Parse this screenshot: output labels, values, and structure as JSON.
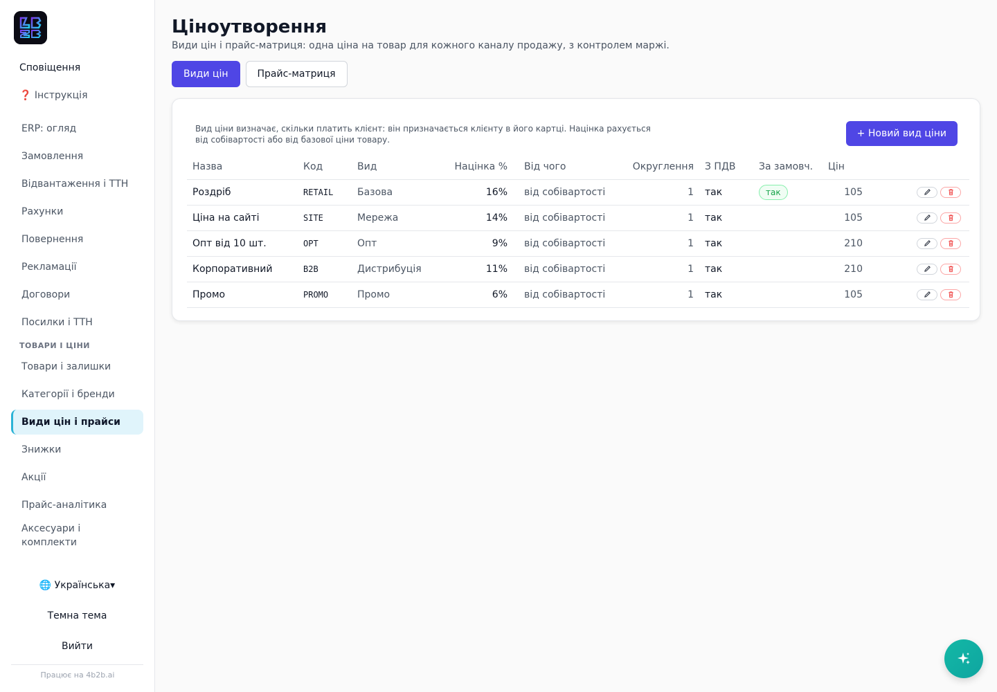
{
  "sidebar": {
    "top_items": [
      {
        "label": "Сповіщення"
      },
      {
        "label": "❓ Інструкція"
      }
    ],
    "erp_items": [
      {
        "label": "ERP: огляд"
      },
      {
        "label": "Замовлення"
      },
      {
        "label": "Відвантаження і ТТН"
      },
      {
        "label": "Рахунки"
      },
      {
        "label": "Повернення"
      },
      {
        "label": "Рекламації"
      },
      {
        "label": "Договори"
      },
      {
        "label": "Посилки і ТТН"
      }
    ],
    "section_title": "ТОВАРИ І ЦІНИ",
    "goods_items": [
      {
        "label": "Товари і залишки"
      },
      {
        "label": "Категорії і бренди"
      },
      {
        "label": "Види цін і прайси"
      },
      {
        "label": "Знижки"
      },
      {
        "label": "Акції"
      },
      {
        "label": "Прайс-аналітика"
      },
      {
        "label": "Аксесуари і комплекти"
      }
    ],
    "active_label": "Види цін і прайси",
    "language": "🌐 Українська▾",
    "theme": "Темна тема",
    "logout": "Вийти",
    "powered_by": "Працює на 4b2b.ai"
  },
  "header": {
    "title": "Ціноутворення",
    "subtitle": "Види цін і прайс-матриця: одна ціна на товар для кожного каналу продажу, з контролем маржі."
  },
  "tabs": [
    {
      "label": "Види цін",
      "active": true
    },
    {
      "label": "Прайс-матриця",
      "active": false
    }
  ],
  "card": {
    "description_line1": "Вид ціни визначає, скільки платить клієнт: він призначається клієнту в його картці. Націнка рахується",
    "description_line2": "від собівартості або від базової ціни товару.",
    "new_button": "+ Новий вид ціни"
  },
  "table": {
    "columns": [
      "Назва",
      "Код",
      "Вид",
      "Націнка %",
      "Від чого",
      "Округлення",
      "З ПДВ",
      "За замовч.",
      "Цін"
    ],
    "rows": [
      {
        "name": "Роздріб",
        "code": "RETAIL",
        "kind": "Базова",
        "markup": "16%",
        "from": "від собівартості",
        "rounding": "1",
        "vat": "так",
        "default": "так",
        "count": "105"
      },
      {
        "name": "Ціна на сайті",
        "code": "SITE",
        "kind": "Мережа",
        "markup": "14%",
        "from": "від собівартості",
        "rounding": "1",
        "vat": "так",
        "default": "",
        "count": "105"
      },
      {
        "name": "Опт від 10 шт.",
        "code": "OPT",
        "kind": "Опт",
        "markup": "9%",
        "from": "від собівартості",
        "rounding": "1",
        "vat": "так",
        "default": "",
        "count": "210"
      },
      {
        "name": "Корпоративний",
        "code": "B2B",
        "kind": "Дистрибуція",
        "markup": "11%",
        "from": "від собівартості",
        "rounding": "1",
        "vat": "так",
        "default": "",
        "count": "210"
      },
      {
        "name": "Промо",
        "code": "PROMO",
        "kind": "Промо",
        "markup": "6%",
        "from": "від собівартості",
        "rounding": "1",
        "vat": "так",
        "default": "",
        "count": "105"
      }
    ]
  },
  "colors": {
    "accent": "#4f46e5",
    "active_nav_bg": "#e0f4fb",
    "active_nav_border": "#2bb3d6",
    "pill_green": "#16a34a",
    "delete_red": "#ef4444",
    "fab": "#14b8a6"
  },
  "icons": {
    "logo": "4b2b-logo-icon",
    "edit": "pencil-icon",
    "delete": "trash-icon",
    "fab": "sparkle-icon"
  }
}
